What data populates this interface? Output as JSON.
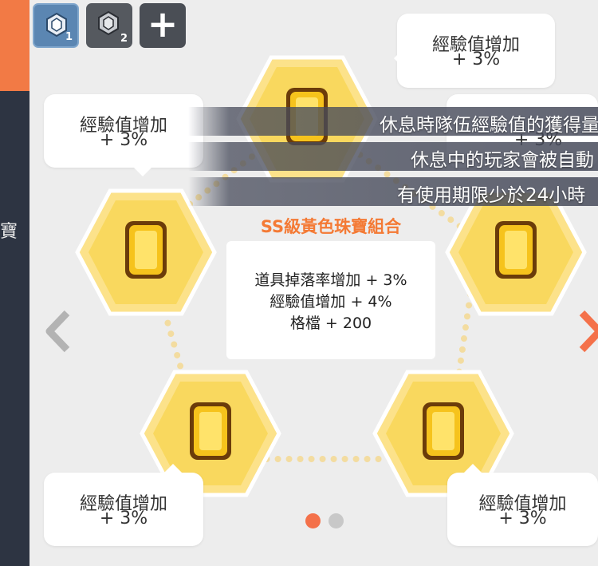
{
  "sidebar": {
    "vertical_text": "寶",
    "accent_color": "#f27a45",
    "bg_color": "#2d3442"
  },
  "tabs": [
    {
      "number": "1",
      "icon": "gem-icon",
      "active": true
    },
    {
      "number": "2",
      "icon": "gem-icon",
      "active": false
    },
    {
      "label": "+",
      "icon": "plus-icon"
    }
  ],
  "bubbles": {
    "top_right": {
      "line1": "經驗值增加",
      "line2": "+ 3%"
    },
    "top_left": {
      "line1": "經驗值增加",
      "line2": "+ 3%"
    },
    "bottom_left": {
      "line1": "經驗值增加",
      "line2": "+ 3%"
    },
    "bottom_right": {
      "line1": "經驗值增加",
      "line2": "+ 3%"
    },
    "behind_right": {
      "line2": "+ 3%"
    }
  },
  "notifications": [
    {
      "text": "休息時隊伍經驗值的獲得量"
    },
    {
      "text": "休息中的玩家會被自動"
    },
    {
      "text": "有使用期限少於24小時"
    }
  ],
  "set": {
    "title": "SS級黃色珠寶組合",
    "effects": [
      "道具掉落率增加 + 3%",
      "經驗值增加 + 4%",
      "格檔 + 200"
    ]
  },
  "pagination": {
    "total": 2,
    "current": 1,
    "active_color": "#f4714a",
    "inactive_color": "#c8c8c8"
  },
  "colors": {
    "accent": "#f47a35",
    "hex_gold": "#f9d85e",
    "jewel": "#f6c31c"
  }
}
